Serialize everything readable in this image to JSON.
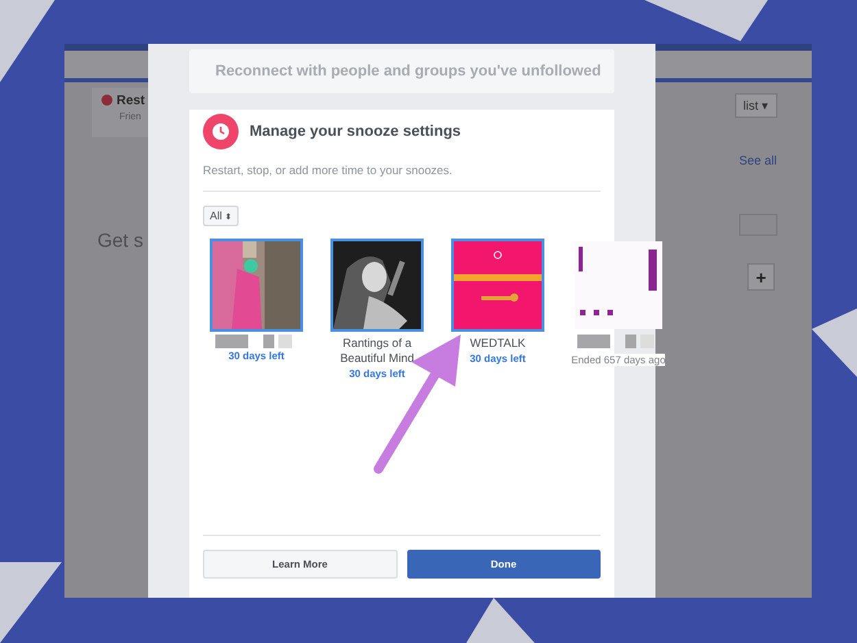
{
  "background_page": {
    "card_title": "Rest",
    "card_subtitle": "Frien",
    "heading": "Get s",
    "list_button": "list ▾",
    "see_all_link": "See all",
    "add_button": "+"
  },
  "modal": {
    "reconnect": {
      "label": "Reconnect with people and groups you've unfollowed"
    },
    "snooze": {
      "title": "Manage your snooze settings",
      "subtitle": "Restart, stop, or add more time to your snoozes.",
      "filter": {
        "value": "All",
        "caret": "⬍"
      },
      "items": [
        {
          "kind": "active",
          "outlined": true,
          "name_blurred": true,
          "status": "30 days left"
        },
        {
          "kind": "active",
          "outlined": true,
          "name": "Rantings of a Beautiful Mind",
          "status": "30 days left"
        },
        {
          "kind": "active",
          "outlined": true,
          "name": "WEDTALK",
          "status": "30 days left"
        },
        {
          "kind": "ended",
          "outlined": false,
          "name_blurred": true,
          "status": "Ended 657 days ago"
        }
      ]
    },
    "buttons": [
      {
        "label": "Learn More",
        "kind": "secondary"
      },
      {
        "label": "Done",
        "kind": "primary"
      }
    ]
  },
  "annotation": {
    "kind": "arrow"
  }
}
